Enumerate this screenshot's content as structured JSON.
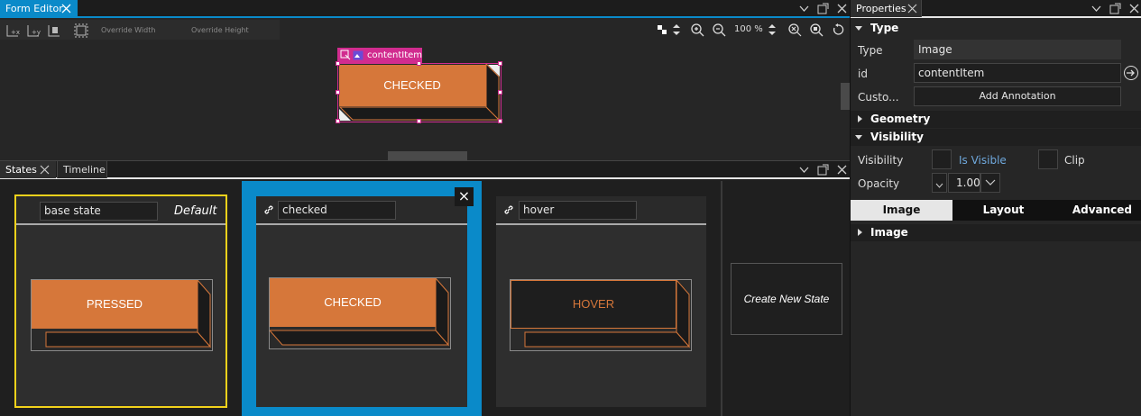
{
  "form_editor": {
    "tab_label": "Form Editor",
    "override_width": "Override Width",
    "override_height": "Override Height",
    "zoom": "100 %",
    "item_label": "contentItem",
    "canvas_button_text": "CHECKED"
  },
  "states_panel": {
    "tabs": [
      "States",
      "Timeline"
    ],
    "states": [
      {
        "name": "base state",
        "tag": "Default",
        "preview_text": "PRESSED"
      },
      {
        "name": "checked",
        "tag": "",
        "preview_text": "CHECKED"
      },
      {
        "name": "hover",
        "tag": "",
        "preview_text": "HOVER"
      }
    ],
    "create_label": "Create New State",
    "close_symbol": "×"
  },
  "properties": {
    "tab_label": "Properties",
    "type_section": "Type",
    "type_label": "Type",
    "type_value": "Image",
    "id_label": "id",
    "id_value": "contentItem",
    "custom_label": "Custo...",
    "add_annotation": "Add Annotation",
    "geometry_section": "Geometry",
    "visibility_section": "Visibility",
    "visibility_label": "Visibility",
    "is_visible": "Is Visible",
    "clip": "Clip",
    "opacity_label": "Opacity",
    "opacity_value": "1.00",
    "subtabs": [
      "Image",
      "Layout",
      "Advanced"
    ],
    "image_section": "Image"
  },
  "colors": {
    "accent_blue": "#0a8ac9",
    "orange": "#d6773a",
    "magenta": "#d12c8f",
    "yellow": "#f2d21b",
    "link_blue": "#6fa8dc"
  }
}
